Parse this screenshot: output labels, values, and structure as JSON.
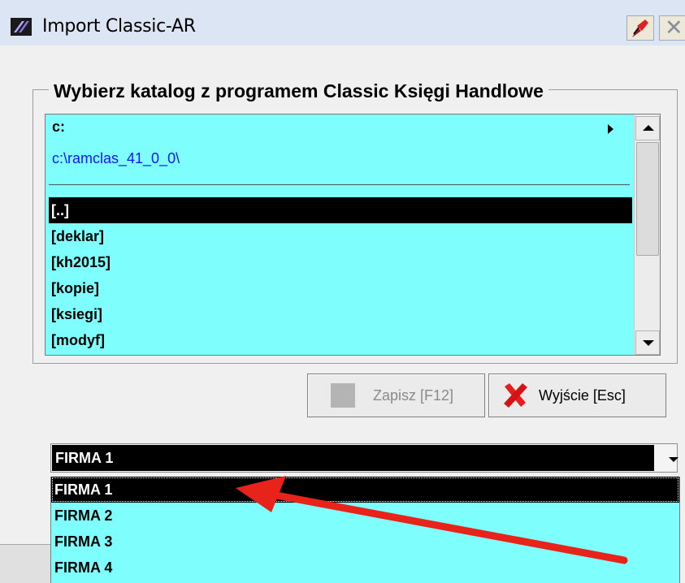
{
  "window": {
    "title": "Import Classic-AR"
  },
  "group": {
    "legend": "Wybierz katalog z programem Classic Księgi Handlowe"
  },
  "file_browser": {
    "drive": "c:",
    "path": "c:\\ramclas_41_0_0\\",
    "directories": [
      "[..]",
      "[deklar]",
      "[kh2015]",
      "[kopie]",
      "[ksiegi]",
      "[modyf]"
    ],
    "selected_index": 0
  },
  "buttons": {
    "save_label": "Zapisz  [F12]",
    "exit_label": "Wyjście  [Esc]"
  },
  "company_select": {
    "selected": "FIRMA 1",
    "options": [
      "FIRMA 1",
      "FIRMA 2",
      "FIRMA 3",
      "FIRMA 4"
    ]
  },
  "colors": {
    "list_background": "#7ffefe",
    "selection": "#000000",
    "path_text": "#1414ff",
    "annotation_arrow": "#e8231a"
  }
}
